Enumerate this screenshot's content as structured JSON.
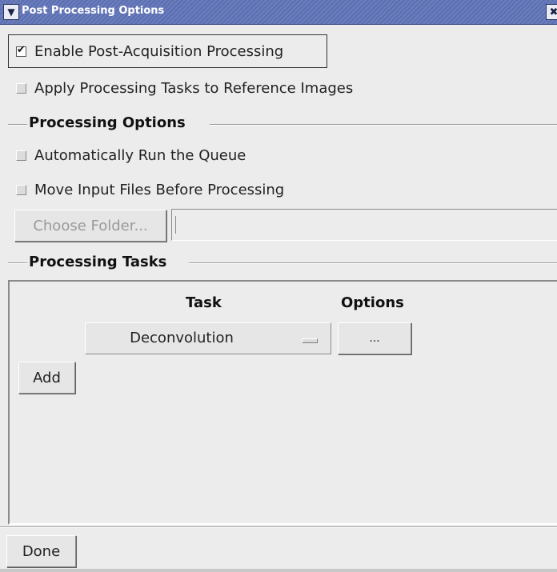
{
  "window": {
    "title": "Post Processing Options",
    "menu_icon": "chevron-down-icon",
    "close_icon": "close-icon",
    "title_color": "#5c6fb0"
  },
  "options": {
    "enable_post": {
      "label": "Enable Post-Acquisition Processing",
      "checked": true
    },
    "apply_reference": {
      "label": "Apply Processing Tasks to Reference Images",
      "checked": false
    }
  },
  "processing_options": {
    "title": "Processing Options",
    "auto_run": {
      "label": "Automatically Run the Queue",
      "checked": false
    },
    "move_input": {
      "label": "Move Input Files Before Processing",
      "checked": false
    },
    "choose_folder_label": "Choose Folder...",
    "folder_path": ""
  },
  "processing_tasks": {
    "title": "Processing Tasks",
    "column_task": "Task",
    "column_options": "Options",
    "tasks": [
      {
        "task": "Deconvolution",
        "options_label": "..."
      }
    ],
    "add_label": "Add"
  },
  "footer": {
    "done_label": "Done"
  }
}
